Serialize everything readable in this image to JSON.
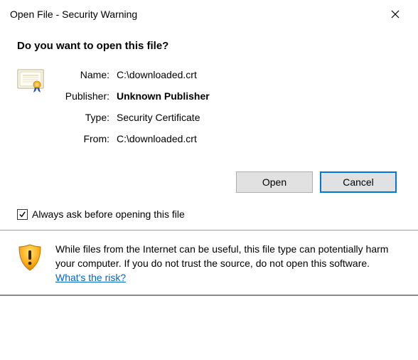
{
  "window": {
    "title": "Open File - Security Warning"
  },
  "heading": "Do you want to open this file?",
  "fields": {
    "name_label": "Name:",
    "name_value": "C:\\downloaded.crt",
    "publisher_label": "Publisher:",
    "publisher_value": "Unknown Publisher",
    "type_label": "Type:",
    "type_value": "Security Certificate",
    "from_label": "From:",
    "from_value": "C:\\downloaded.crt"
  },
  "buttons": {
    "open": "Open",
    "cancel": "Cancel"
  },
  "checkbox": {
    "label": "Always ask before opening this file",
    "checked": true
  },
  "footer": {
    "text": "While files from the Internet can be useful, this file type can potentially harm your computer. If you do not trust the source, do not open this software. ",
    "link": "What's the risk?"
  }
}
